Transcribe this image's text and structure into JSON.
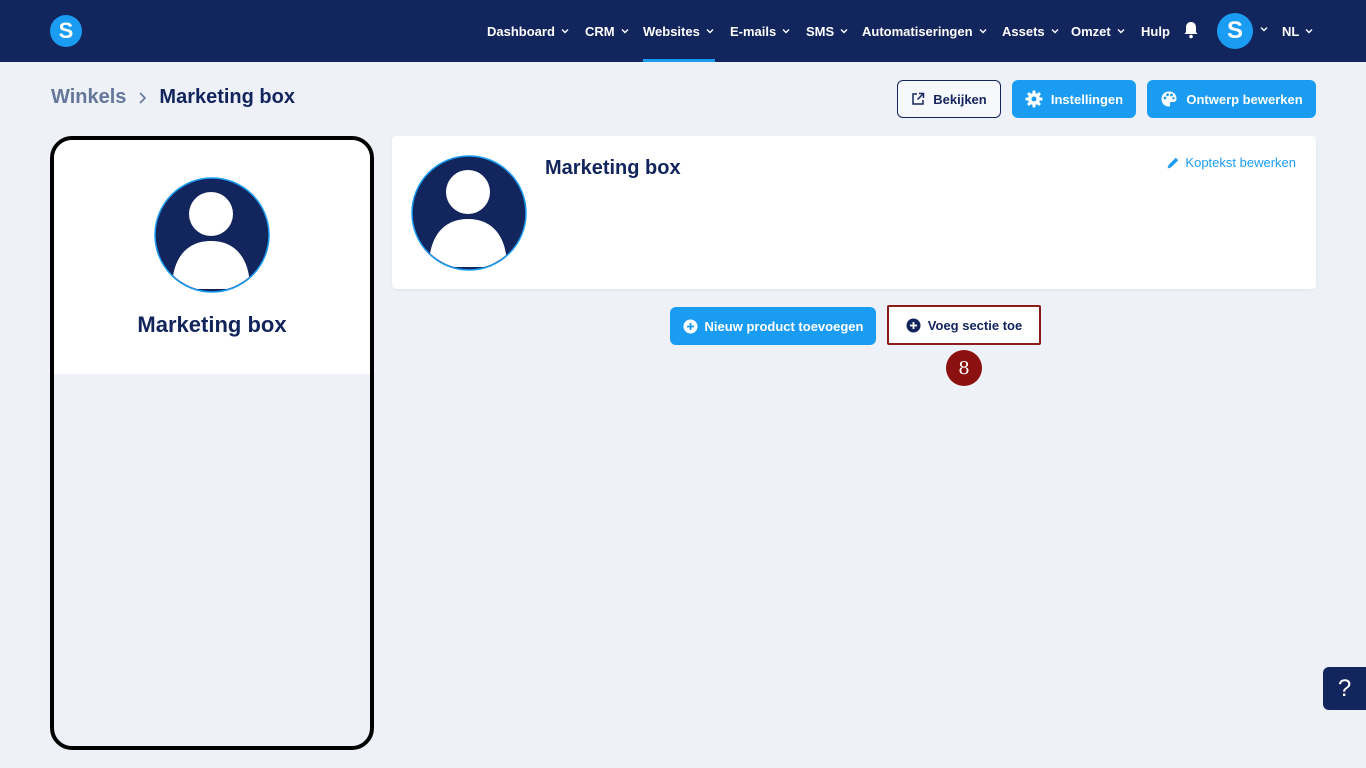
{
  "app": {
    "logo_letter": "S"
  },
  "nav": {
    "items": [
      {
        "label": "Dashboard",
        "has_dropdown": true,
        "active": false
      },
      {
        "label": "CRM",
        "has_dropdown": true,
        "active": false
      },
      {
        "label": "Websites",
        "has_dropdown": true,
        "active": true
      },
      {
        "label": "E-mails",
        "has_dropdown": true,
        "active": false
      },
      {
        "label": "SMS",
        "has_dropdown": true,
        "active": false
      },
      {
        "label": "Automatiseringen",
        "has_dropdown": true,
        "active": false
      },
      {
        "label": "Assets",
        "has_dropdown": true,
        "active": false
      },
      {
        "label": "Omzet",
        "has_dropdown": true,
        "active": false
      },
      {
        "label": "Hulp",
        "has_dropdown": false,
        "active": false
      }
    ],
    "bell_icon": "bell-icon",
    "avatar_letter": "S",
    "language": "NL"
  },
  "breadcrumb": {
    "parent": "Winkels",
    "current": "Marketing box"
  },
  "toolbar": {
    "view_label": "Bekijken",
    "settings_label": "Instellingen",
    "design_label": "Ontwerp bewerken"
  },
  "preview": {
    "title": "Marketing box"
  },
  "header_card": {
    "title": "Marketing box",
    "edit_label": "Koptekst bewerken"
  },
  "actions": {
    "add_product_label": "Nieuw product toevoegen",
    "add_section_label": "Voeg sectie toe"
  },
  "annotation": {
    "step": "8"
  },
  "help": {
    "label": "?"
  },
  "colors": {
    "navy": "#13255d",
    "accent": "#1b9cf3",
    "highlight": "#8b1a1a"
  }
}
